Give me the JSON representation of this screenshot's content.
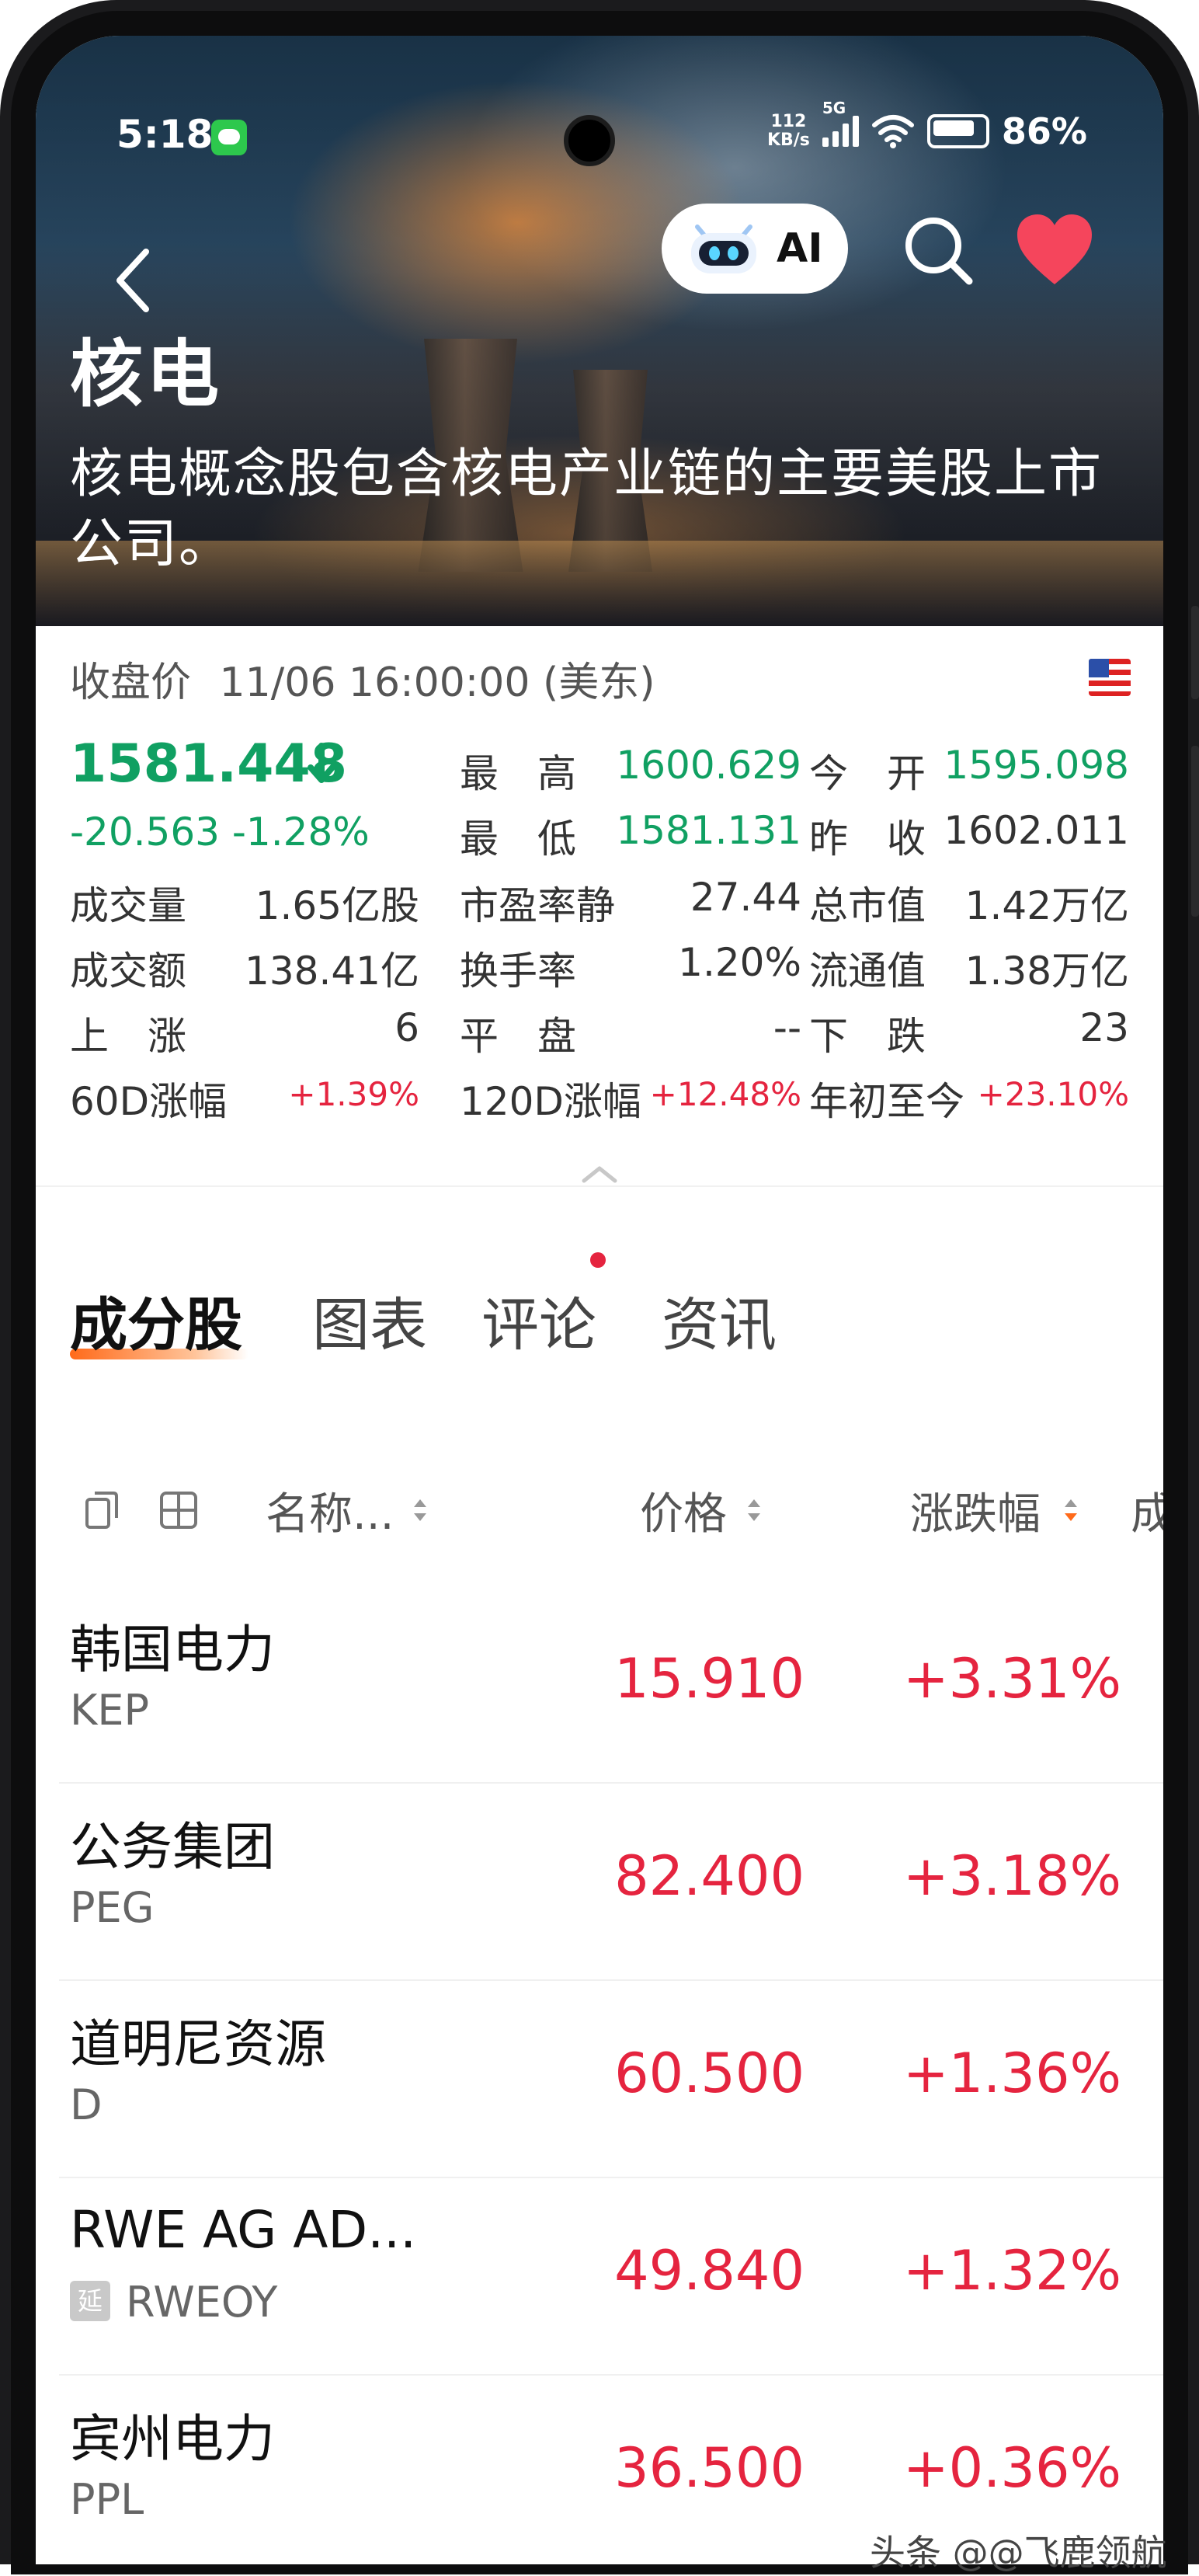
{
  "status_bar": {
    "time": "5:18",
    "net_speed_top": "112",
    "net_speed_unit": "KB/s",
    "network_type": "5G",
    "battery": "86%"
  },
  "header": {
    "title": "核电",
    "description": "核电概念股包含核电产业链的主要美股上市公司。",
    "ai_label": "AI"
  },
  "quote": {
    "close_label": "收盘价",
    "close_time": "11/06 16:00:00 (美东)",
    "price": "1581.448",
    "change": "-20.563 -1.28%",
    "col1": [
      {
        "label": "成交量",
        "value": "1.65亿股"
      },
      {
        "label": "成交额",
        "value": "138.41亿"
      },
      {
        "label": "上　涨",
        "value": "6"
      },
      {
        "label": "60D涨幅",
        "value": "+1.39%"
      }
    ],
    "col2": [
      {
        "label": "最　高",
        "value": "1600.629"
      },
      {
        "label": "最　低",
        "value": "1581.131"
      },
      {
        "label": "市盈率静",
        "value": "27.44"
      },
      {
        "label": "换手率",
        "value": "1.20%"
      },
      {
        "label": "平　盘",
        "value": "--"
      },
      {
        "label": "120D涨幅",
        "value": "+12.48%"
      }
    ],
    "col3": [
      {
        "label": "今　开",
        "value": "1595.098"
      },
      {
        "label": "昨　收",
        "value": "1602.011"
      },
      {
        "label": "总市值",
        "value": "1.42万亿"
      },
      {
        "label": "流通值",
        "value": "1.38万亿"
      },
      {
        "label": "下　跌",
        "value": "23"
      },
      {
        "label": "年初至今",
        "value": "+23.10%"
      }
    ]
  },
  "tabs": [
    {
      "label": "成分股"
    },
    {
      "label": "图表"
    },
    {
      "label": "评论"
    },
    {
      "label": "资讯"
    }
  ],
  "table": {
    "col_name": "名称...",
    "col_price": "价格",
    "col_change": "涨跌幅",
    "col_cut": "成",
    "rows": [
      {
        "name": "韩国电力",
        "code": "KEP",
        "price": "15.910",
        "change": "+3.31%"
      },
      {
        "name": "公务集团",
        "code": "PEG",
        "price": "82.400",
        "change": "+3.18%"
      },
      {
        "name": "道明尼资源",
        "code": "D",
        "price": "60.500",
        "change": "+1.36%"
      },
      {
        "name": "RWE AG AD...",
        "code": "RWEOY",
        "badge": "延",
        "price": "49.840",
        "change": "+1.32%"
      },
      {
        "name": "宾州电力",
        "code": "PPL",
        "price": "36.500",
        "change": "+0.36%"
      }
    ]
  },
  "watermark": "头条 @@飞鹿领航",
  "colors": {
    "up": "#e5243f",
    "down": "#10a062",
    "accent": "#ff6a1a"
  }
}
